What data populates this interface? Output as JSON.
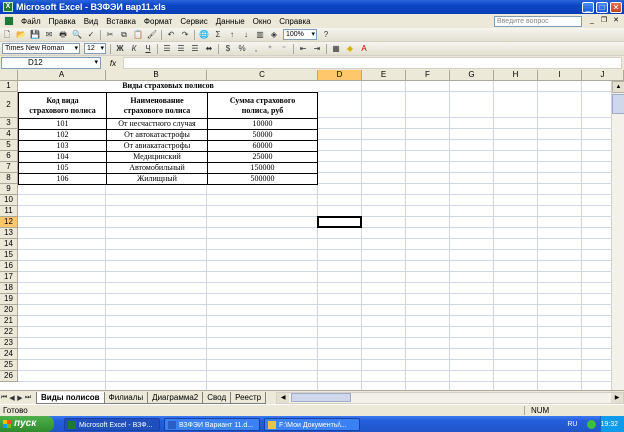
{
  "window": {
    "title": "Microsoft Excel - ВЗФЭИ вар11.xls"
  },
  "menu": [
    "Файл",
    "Правка",
    "Вид",
    "Вставка",
    "Формат",
    "Сервис",
    "Данные",
    "Окно",
    "Справка"
  ],
  "help_placeholder": "Введите вопрос",
  "toolbar": {
    "font_name": "Times New Roman",
    "font_size": "12",
    "zoom": "100%",
    "bold": "Ж",
    "italic": "К",
    "underline": "Ч"
  },
  "formula_bar": {
    "name_box": "D12",
    "fx": "fx",
    "value": ""
  },
  "columns": [
    "A",
    "B",
    "C",
    "D",
    "E",
    "F",
    "G",
    "H",
    "I",
    "J"
  ],
  "rows": [
    "1",
    "2",
    "3",
    "4",
    "5",
    "6",
    "7",
    "8",
    "9",
    "10",
    "11",
    "12",
    "13",
    "14",
    "15",
    "16",
    "17",
    "18",
    "19",
    "20",
    "21",
    "22",
    "23",
    "24",
    "25",
    "26"
  ],
  "sheet": {
    "title": "Виды страховых  полисов",
    "headers": [
      "Код вида страхового полиса",
      "Наименование страхового полиса",
      "Сумма страхового полиса, руб"
    ],
    "header_lines": [
      [
        "Код вида",
        "страхового полиса"
      ],
      [
        "Наименование",
        "страхового полиса"
      ],
      [
        "Сумма страхового",
        "полиса, руб"
      ]
    ],
    "data": [
      [
        "101",
        "От несчастного случая",
        "10000"
      ],
      [
        "102",
        "От автокатастрофы",
        "50000"
      ],
      [
        "103",
        "От авиакатастрофы",
        "60000"
      ],
      [
        "104",
        "Медицинский",
        "25000"
      ],
      [
        "105",
        "Автомобильный",
        "150000"
      ],
      [
        "106",
        "Жилищный",
        "500000"
      ]
    ]
  },
  "tabs": [
    "Виды полисов",
    "Филиалы",
    "Диаграмма2",
    "Свод",
    "Реестр"
  ],
  "active_tab": "Виды полисов",
  "status": {
    "left": "Готово",
    "num": "NUM"
  },
  "taskbar": {
    "start": "пуск",
    "tasks": [
      "Microsoft Excel - ВЗФ...",
      "ВЗФЭИ Вариант 11.d...",
      "F:\\Мои Документы\\..."
    ],
    "lang": "RU",
    "clock": "19:32"
  }
}
